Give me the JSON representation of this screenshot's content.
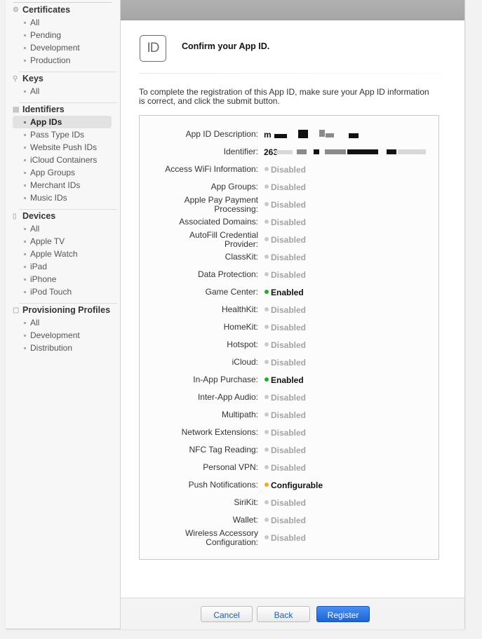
{
  "sidebar": {
    "sections": [
      {
        "title": "Certificates",
        "icon": "certificate-icon",
        "items": [
          "All",
          "Pending",
          "Development",
          "Production"
        ]
      },
      {
        "title": "Keys",
        "icon": "key-icon",
        "items": [
          "All"
        ]
      },
      {
        "title": "Identifiers",
        "icon": "identifier-icon",
        "items": [
          "App IDs",
          "Pass Type IDs",
          "Website Push IDs",
          "iCloud Containers",
          "App Groups",
          "Merchant IDs",
          "Music IDs"
        ]
      },
      {
        "title": "Devices",
        "icon": "device-icon",
        "items": [
          "All",
          "Apple TV",
          "Apple Watch",
          "iPad",
          "iPhone",
          "iPod Touch"
        ]
      },
      {
        "title": "Provisioning Profiles",
        "icon": "document-icon",
        "items": [
          "All",
          "Development",
          "Distribution"
        ]
      }
    ],
    "active_item": "App IDs"
  },
  "header": {
    "icon_text": "ID",
    "title": "Confirm your App ID."
  },
  "intro": "To complete the registration of this App ID, make sure your App ID information is correct, and click the submit button.",
  "details": {
    "description_label": "App ID Description:",
    "description_value": "m",
    "identifier_label": "Identifier:",
    "identifier_value": "263",
    "capabilities": [
      {
        "label": "Access WiFi Information:",
        "status": "Disabled",
        "state": "disabled"
      },
      {
        "label": "App Groups:",
        "status": "Disabled",
        "state": "disabled"
      },
      {
        "label": "Apple Pay Payment Processing:",
        "status": "Disabled",
        "state": "disabled"
      },
      {
        "label": "Associated Domains:",
        "status": "Disabled",
        "state": "disabled"
      },
      {
        "label": "AutoFill Credential Provider:",
        "status": "Disabled",
        "state": "disabled"
      },
      {
        "label": "ClassKit:",
        "status": "Disabled",
        "state": "disabled"
      },
      {
        "label": "Data Protection:",
        "status": "Disabled",
        "state": "disabled"
      },
      {
        "label": "Game Center:",
        "status": "Enabled",
        "state": "enabled"
      },
      {
        "label": "HealthKit:",
        "status": "Disabled",
        "state": "disabled"
      },
      {
        "label": "HomeKit:",
        "status": "Disabled",
        "state": "disabled"
      },
      {
        "label": "Hotspot:",
        "status": "Disabled",
        "state": "disabled"
      },
      {
        "label": "iCloud:",
        "status": "Disabled",
        "state": "disabled"
      },
      {
        "label": "In-App Purchase:",
        "status": "Enabled",
        "state": "enabled"
      },
      {
        "label": "Inter-App Audio:",
        "status": "Disabled",
        "state": "disabled"
      },
      {
        "label": "Multipath:",
        "status": "Disabled",
        "state": "disabled"
      },
      {
        "label": "Network Extensions:",
        "status": "Disabled",
        "state": "disabled"
      },
      {
        "label": "NFC Tag Reading:",
        "status": "Disabled",
        "state": "disabled"
      },
      {
        "label": "Personal VPN:",
        "status": "Disabled",
        "state": "disabled"
      },
      {
        "label": "Push Notifications:",
        "status": "Configurable",
        "state": "configurable"
      },
      {
        "label": "SiriKit:",
        "status": "Disabled",
        "state": "disabled"
      },
      {
        "label": "Wallet:",
        "status": "Disabled",
        "state": "disabled"
      },
      {
        "label": "Wireless Accessory Configuration:",
        "status": "Disabled",
        "state": "disabled"
      }
    ]
  },
  "footer": {
    "cancel_label": "Cancel",
    "back_label": "Back",
    "register_label": "Register"
  },
  "colors": {
    "enabled": "#21b024",
    "configurable": "#f2a81d",
    "disabled": "#c9c9c9",
    "primary_button": "#1d63d6"
  }
}
